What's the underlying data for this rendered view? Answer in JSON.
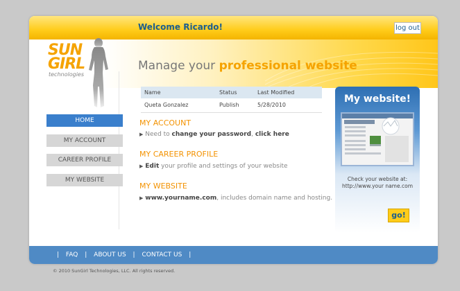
{
  "header": {
    "welcome": "Welcome Ricardo!",
    "logout_label": "log out"
  },
  "logo": {
    "main": "SUN GIRL",
    "line1": "SUN",
    "line2": "GIRL",
    "sub": "technologies"
  },
  "page_title": {
    "prefix": "Manage your ",
    "accent": "professional website"
  },
  "nav": [
    {
      "label": "HOME",
      "active": true
    },
    {
      "label": "MY ACCOUNT",
      "active": false
    },
    {
      "label": "CAREER PROFILE",
      "active": false
    },
    {
      "label": "MY WEBSITE",
      "active": false
    }
  ],
  "table": {
    "columns": [
      "Name",
      "Status",
      "Last Modified"
    ],
    "rows": [
      [
        "Queta Gonzalez",
        "Publish",
        "5/28/2010"
      ]
    ]
  },
  "sections": {
    "account": {
      "title": "MY ACCOUNT",
      "pre": "Need to ",
      "link1": "change your password",
      "mid": ", ",
      "link2": "click here"
    },
    "career": {
      "title": "MY CAREER PROFILE",
      "link": "Edit",
      "post": " your profile and settings of your website"
    },
    "website": {
      "title": "MY WEBSITE",
      "link": "www.yourname.com",
      "post": ", includes domain name and hosting."
    }
  },
  "promo": {
    "title": "My website!",
    "check": "Check your website at:",
    "url": "http://www.your name.com",
    "go_label": "go!"
  },
  "footer": {
    "links": [
      "FAQ",
      "ABOUT US",
      "CONTACT US"
    ],
    "sep": "|",
    "copyright": "© 2010 SunGirl Technologies, LLC. All rights reserved."
  },
  "colors": {
    "accent": "#f39200",
    "blue": "#3a7fcc",
    "header_text": "#1c5e8e",
    "footer": "#4f8ac5"
  }
}
